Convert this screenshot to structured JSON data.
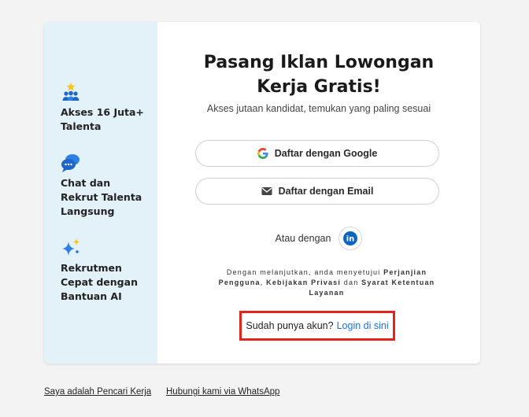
{
  "sidebar": {
    "features": [
      {
        "icon": "users-star-icon",
        "label": "Akses 16 Juta+ Talenta"
      },
      {
        "icon": "chat-bubbles-icon",
        "label": "Chat dan Rekrut Talenta Langsung"
      },
      {
        "icon": "ai-sparkle-icon",
        "label": "Rekrutmen Cepat dengan Bantuan AI"
      }
    ]
  },
  "main": {
    "title": "Pasang Iklan Lowongan Kerja Gratis!",
    "subtitle": "Akses jutaan kandidat, temukan yang paling sesuai",
    "google_button": "Daftar dengan Google",
    "email_button": "Daftar dengan Email",
    "or_label": "Atau dengan",
    "linkedin_label": "in",
    "terms": {
      "prefix": "Dengan melanjutkan, anda menyetujui ",
      "link1": "Perjanjian Pengguna",
      "sep1": ", ",
      "link2": "Kebijakan Privasi",
      "sep2": " dan ",
      "link3": "Syarat Ketentuan Layanan"
    },
    "login_prompt": "Sudah punya akun?",
    "login_link": "Login di sini"
  },
  "footer": {
    "job_seeker_link": "Saya adalah Pencari Kerja",
    "whatsapp_link": "Hubungi kami via WhatsApp"
  },
  "colors": {
    "sidebar_bg": "#e3f1f9",
    "accent_blue": "#1a73e8",
    "highlight_red": "#e3241b",
    "linkedin_blue": "#0a66c2"
  }
}
